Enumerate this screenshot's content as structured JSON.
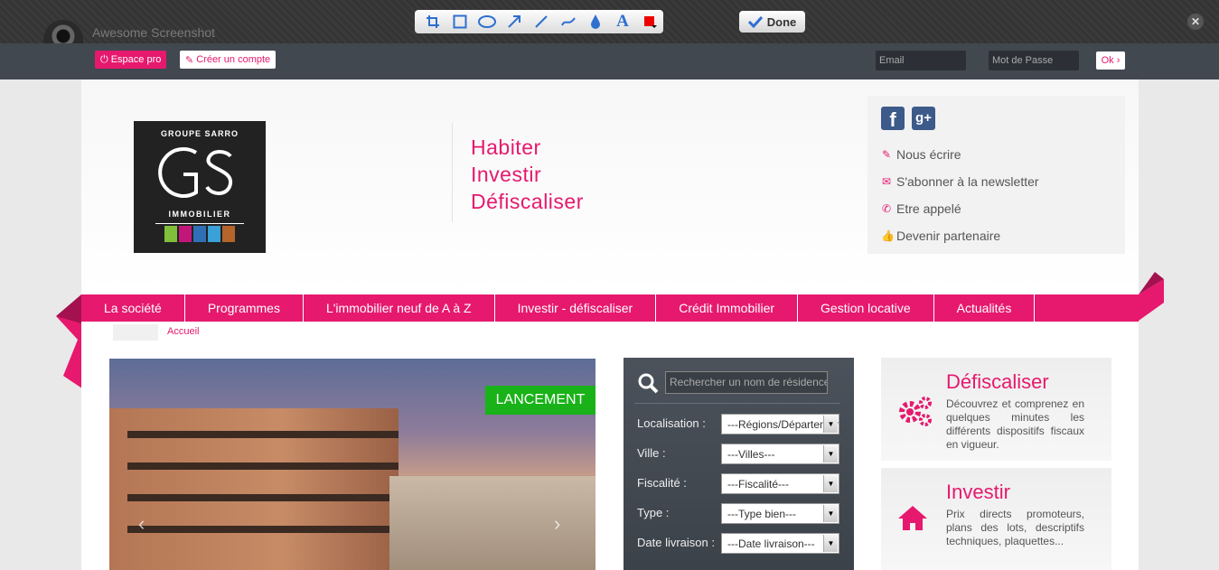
{
  "tool": {
    "title": "Awesome Screenshot",
    "done_label": "Done",
    "close_label": "✕",
    "tools": [
      "crop-icon",
      "rectangle-icon",
      "ellipse-icon",
      "arrow-icon",
      "line-icon",
      "freehand-icon",
      "blur-icon",
      "text-icon",
      "color-picker-icon"
    ]
  },
  "topbar": {
    "pro_label": "Espace pro",
    "create_label": "Créer un compte",
    "email_placeholder": "Email",
    "password_placeholder": "Mot de Passe",
    "ok_label": "Ok ›"
  },
  "logo": {
    "top": "GROUPE SARRO",
    "mark": "GS",
    "bottom": "IMMOBILIER",
    "colors": [
      "#7fbf3a",
      "#c2177a",
      "#2f6fb5",
      "#3aa0d8",
      "#b5642b"
    ]
  },
  "tagline": [
    "Habiter",
    "Investir",
    "Défiscaliser"
  ],
  "contact": {
    "facebook": "f",
    "googleplus": "g+",
    "links": [
      {
        "icon": "pencil-icon",
        "label": "Nous écrire"
      },
      {
        "icon": "envelope-icon",
        "label": "S'abonner à la newsletter"
      },
      {
        "icon": "phone-icon",
        "label": "Etre appelé"
      },
      {
        "icon": "thumbs-up-icon",
        "label": "Devenir partenaire"
      }
    ]
  },
  "nav": [
    "La société",
    "Programmes",
    "L'immobilier neuf de A à Z",
    "Investir - défiscaliser",
    "Crédit Immobilier",
    "Gestion locative",
    "Actualités"
  ],
  "breadcrumb": "Accueil",
  "slider": {
    "badge": "LANCEMENT",
    "prev": "‹",
    "next": "›"
  },
  "search": {
    "placeholder": "Rechercher un nom de résidence",
    "rows": [
      {
        "label": "Localisation :",
        "value": "---Régions/Départements---"
      },
      {
        "label": "Ville :",
        "value": "---Villes---"
      },
      {
        "label": "Fiscalité :",
        "value": "---Fiscalité---"
      },
      {
        "label": "Type :",
        "value": "---Type bien---"
      },
      {
        "label": "Date livraison :",
        "value": "---Date livraison---"
      }
    ]
  },
  "promos": [
    {
      "title": "Défiscaliser",
      "text": "Découvrez et comprenez en quelques minutes les différents dispositifs fiscaux en vigueur.",
      "icon": "gears-icon"
    },
    {
      "title": "Investir",
      "text": "Prix directs promoteurs, plans des lots, descriptifs techniques, plaquettes...",
      "icon": "home-icon"
    }
  ],
  "colors": {
    "accent": "#e6196e",
    "launch": "#19b219"
  }
}
